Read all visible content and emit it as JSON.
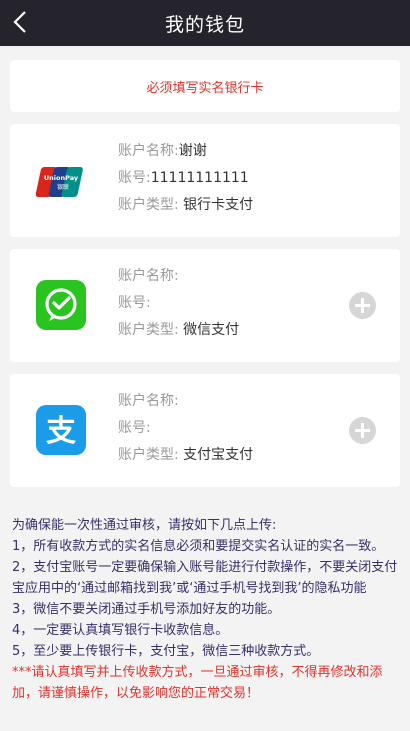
{
  "header": {
    "title": "我的钱包",
    "back_icon": "chevron-left-icon"
  },
  "notice": "必须填写实名银行卡",
  "accounts": [
    {
      "icon": "unionpay-logo",
      "name_label": "账户名称:",
      "name_value": "谢谢",
      "number_label": "账号:",
      "number_value": "11111111111",
      "type_label": "账户类型:",
      "type_value": " 银行卡支付",
      "has_add": false
    },
    {
      "icon": "wechat-icon",
      "name_label": "账户名称:",
      "name_value": "",
      "number_label": "账号:",
      "number_value": "",
      "type_label": "账户类型:",
      "type_value": " 微信支付",
      "has_add": true,
      "add_icon": "plus-circle-icon"
    },
    {
      "icon": "alipay-icon",
      "name_label": "账户名称:",
      "name_value": "",
      "number_label": "账号:",
      "number_value": "",
      "type_label": "账户类型:",
      "type_value": " 支付宝支付",
      "has_add": true,
      "add_icon": "plus-circle-icon"
    }
  ],
  "notes": [
    "为确保能一次性通过审核，请按如下几点上传:",
    "1，所有收款方式的实名信息必须和要提交实名认证的实名一致。",
    "2，支付宝账号一定要确保输入账号能进行付款操作，不要关闭支付宝应用中的‘通过邮箱找到我’或‘通过手机号找到我’的隐私功能",
    "3，微信不要关闭通过手机号添加好友的功能。",
    "4，一定要认真填写银行卡收款信息。",
    "5，至少要上传银行卡，支付宝，微信三种收款方式。",
    "***请认真填写并上传收款方式，一旦通过审核，不得再修改和添加，请谨慎操作，以免影响您的正常交易！"
  ],
  "colors": {
    "header_bg": "#25232b",
    "warning": "#e0342d",
    "wechat": "#29c41f",
    "alipay": "#1a9ce9"
  }
}
